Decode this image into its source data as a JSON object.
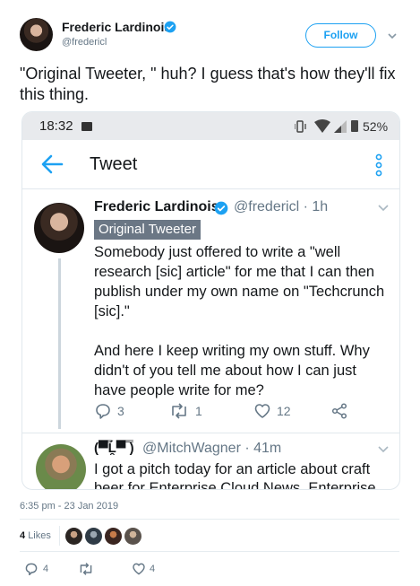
{
  "header": {
    "name": "Frederic Lardinois",
    "handle": "@fredericl",
    "follow_label": "Follow"
  },
  "tweet": {
    "text": "\"Original Tweeter, \" huh? I guess that's how they'll fix this thing."
  },
  "screenshot": {
    "status_time": "18:32",
    "battery": "52%",
    "app_title": "Tweet",
    "quoted_tweet": {
      "name": "Frederic Lardinois",
      "handle_time": "@fredericl · 1h",
      "badge": "Original Tweeter",
      "paragraph1": "Somebody just offered to write a \"well research [sic] article\" for me that I can then publish under my own name on \"Techcrunch [sic].\"",
      "paragraph2": "And here I keep writing my own stuff. Why didn't of you tell me about how I can just have people write for me?",
      "replies": "3",
      "retweets": "1",
      "likes": "12"
    },
    "reply_tweet": {
      "name_emoji": "(▀̿Ĺ̯▀̿ ̿)",
      "handle_time": "@MitchWagner · 41m",
      "text": "I got a pitch today for an article about craft beer for Enterprise Cloud News. Enterprise"
    }
  },
  "meta": {
    "timestamp": "6:35 pm - 23 Jan 2019",
    "likes_count": "4",
    "likes_label": "Likes"
  },
  "actions": {
    "replies": "4",
    "likes": "4"
  },
  "colors": {
    "accent": "#1da1f2",
    "text_primary": "#14171a",
    "text_secondary": "#657786",
    "badge_bg": "#6b7785"
  }
}
